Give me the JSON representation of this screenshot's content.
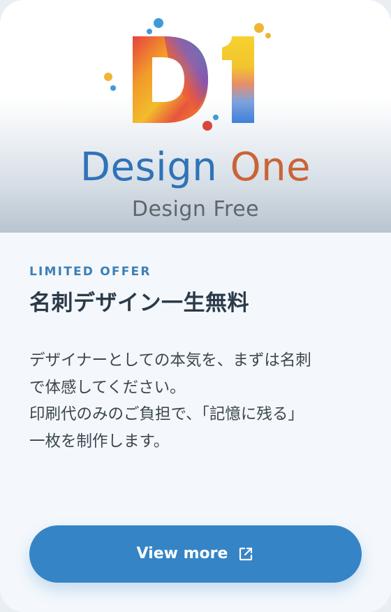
{
  "hero": {
    "logo_mark": "D1",
    "brand_primary": "Design",
    "brand_secondary": "One",
    "brand_tagline": "Design Free"
  },
  "offer": {
    "tag": "LIMITED OFFER",
    "title": "名刺デザイン一生無料",
    "body_lines": [
      "デザイナーとしての本気を、まずは名刺",
      "で体感してください。",
      "印刷代のみのご負担で、「記憶に残る」",
      "一枚を制作します。"
    ]
  },
  "cta": {
    "label": "View more",
    "icon": "external-link-icon"
  },
  "colors": {
    "accent": "#3584c6",
    "tag": "#3d7fb6",
    "brand_blue": "#2f73b8",
    "brand_orange": "#c96436",
    "title": "#2b3a48"
  }
}
